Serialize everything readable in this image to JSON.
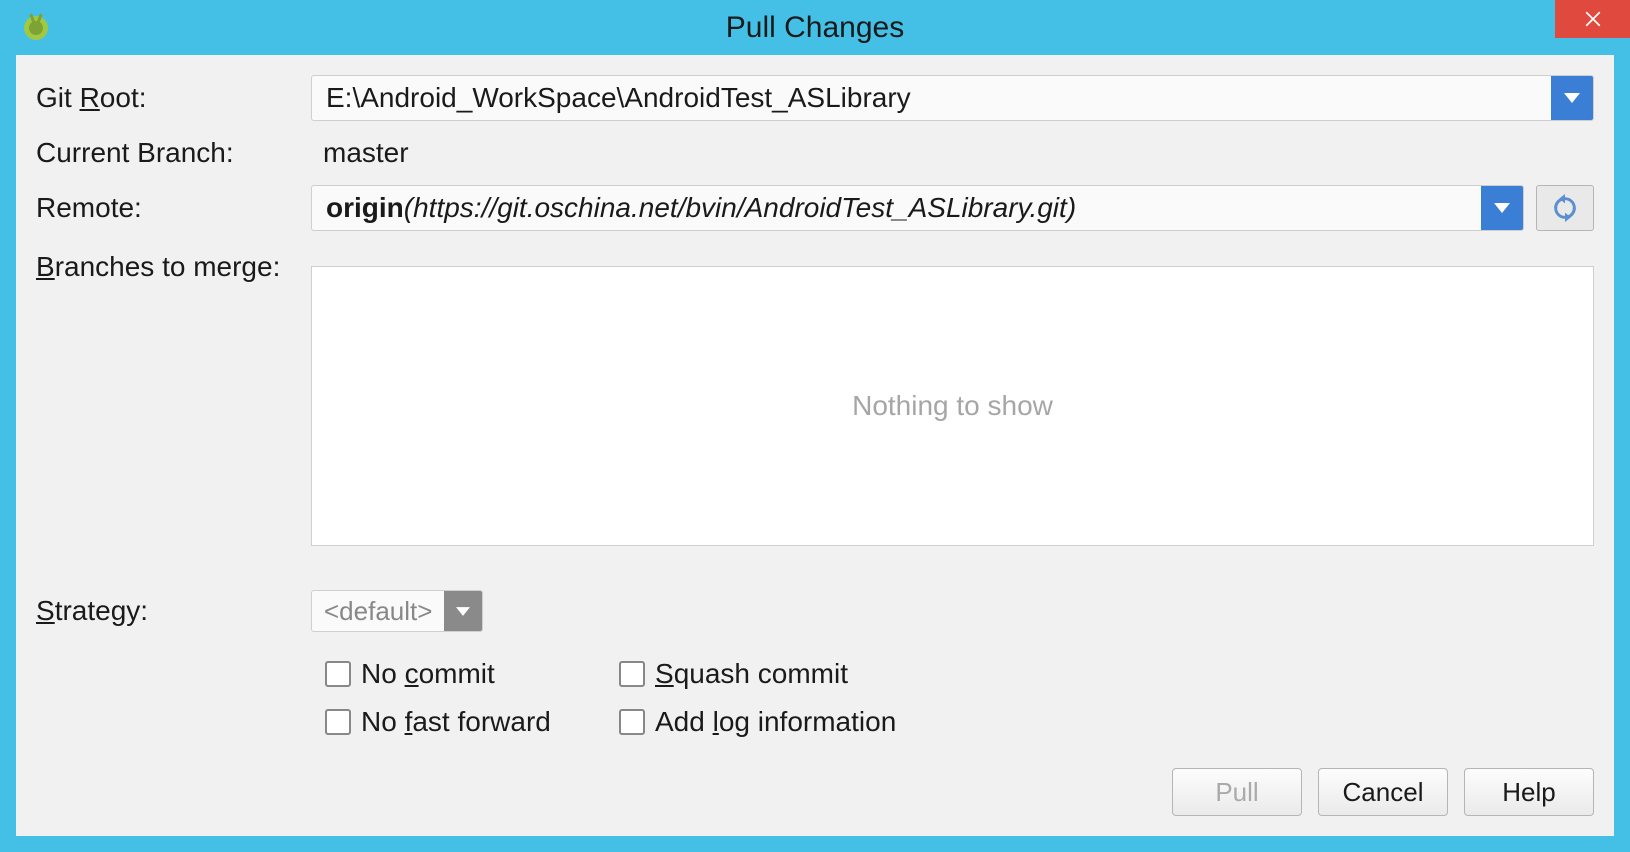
{
  "titlebar": {
    "title": "Pull Changes"
  },
  "labels": {
    "gitRoot": "Git Root:",
    "currentBranch": "Current Branch:",
    "remote": "Remote:",
    "branchesToMerge": "Branches to merge:",
    "strategy": "Strategy:"
  },
  "mnemonics": {
    "gitRoot_pre": "Git ",
    "gitRoot_m": "R",
    "gitRoot_post": "oot:",
    "branches_m": "B",
    "branches_post": "ranches to merge:",
    "strategy_m": "S",
    "strategy_post": "trategy:",
    "noCommit_pre": "No ",
    "noCommit_m": "c",
    "noCommit_post": "ommit",
    "noFast_pre": "No ",
    "noFast_m": "f",
    "noFast_post": "ast forward",
    "squash_m": "S",
    "squash_post": "quash commit",
    "addLog_pre": "Add ",
    "addLog_m": "l",
    "addLog_post": "og information"
  },
  "fields": {
    "gitRoot": "E:\\Android_WorkSpace\\AndroidTest_ASLibrary",
    "currentBranch": "master",
    "remoteName": "origin",
    "remoteUrl": "https://git.oschina.net/bvin/AndroidTest_ASLibrary.git",
    "branchesEmpty": "Nothing to show",
    "strategy": "<default>"
  },
  "buttons": {
    "pull": "Pull",
    "cancel": "Cancel",
    "help": "Help"
  }
}
